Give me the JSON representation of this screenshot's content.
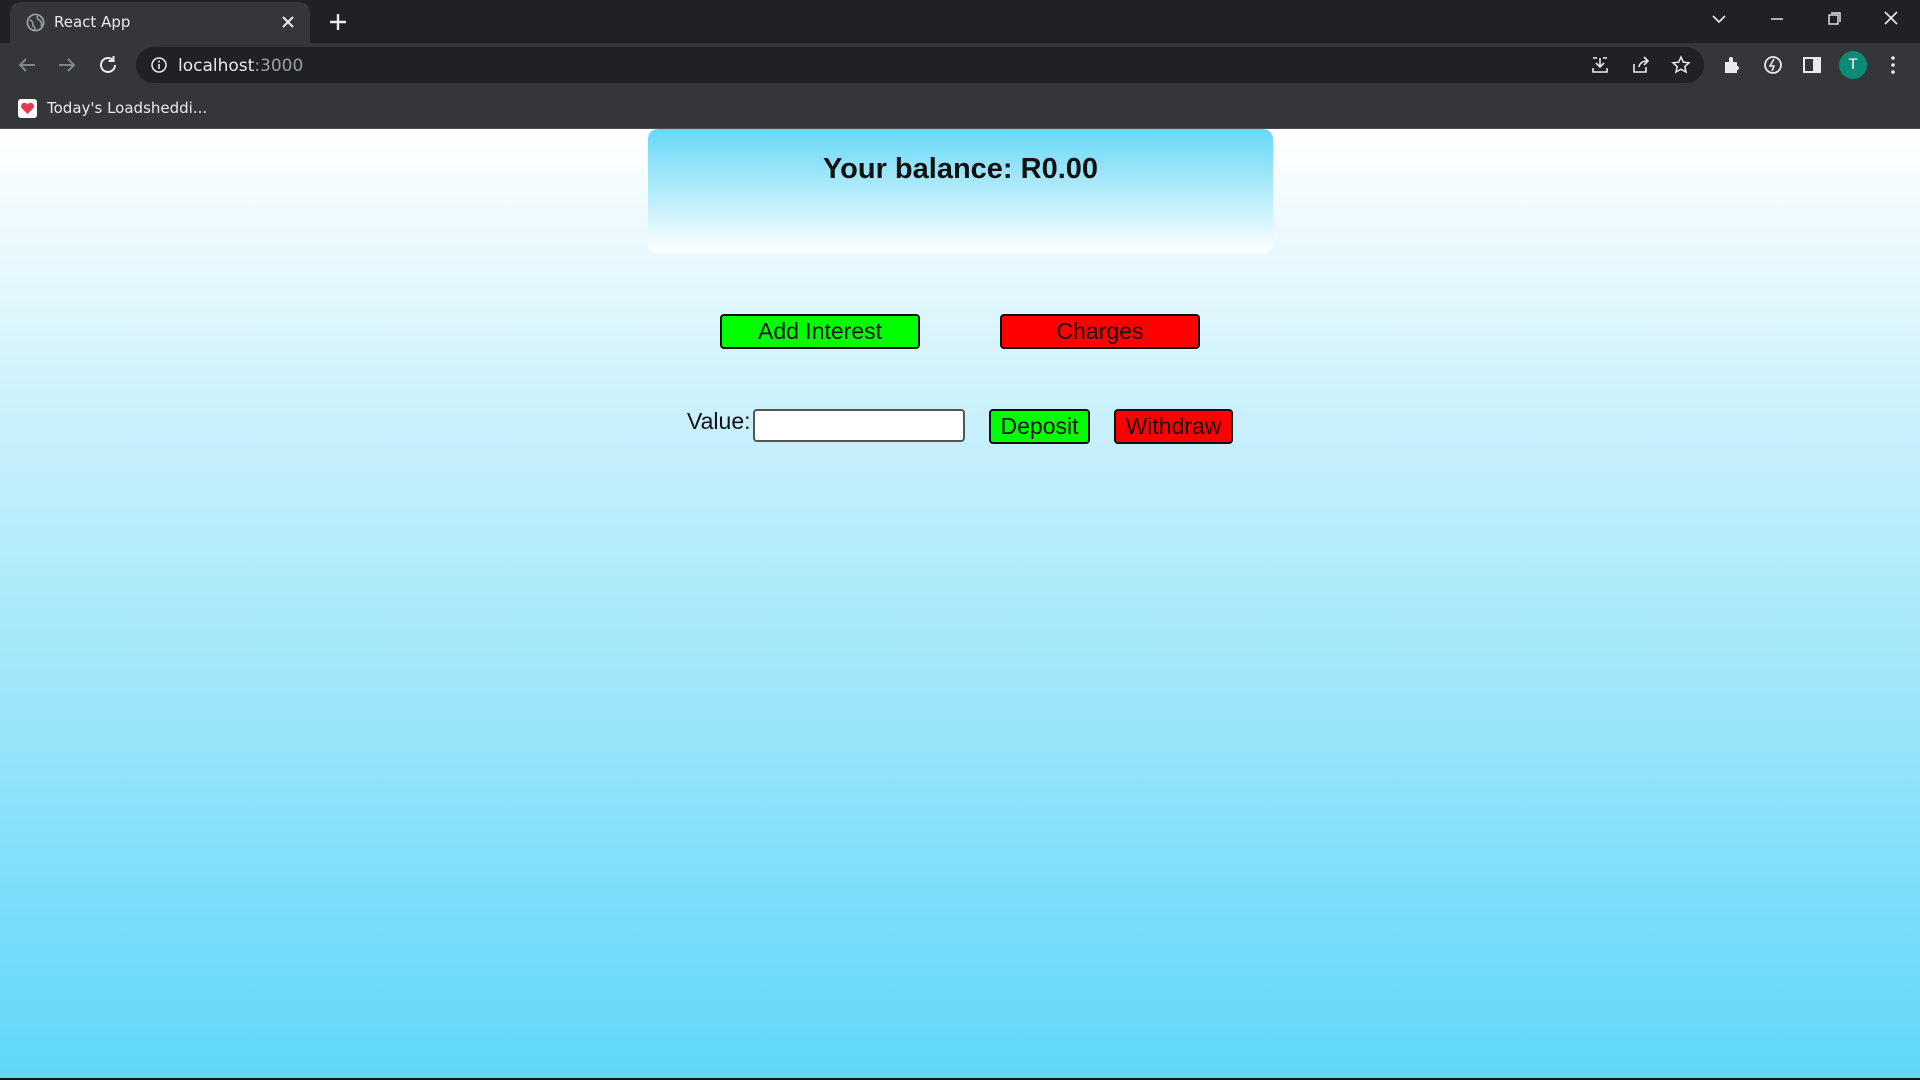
{
  "browser": {
    "tab_title": "React App",
    "url_host": "localhost",
    "url_port": ":3000",
    "bookmark_label": "Today's Loadsheddi...",
    "avatar_letter": "T"
  },
  "app": {
    "balance_text": "Your balance: R0.00",
    "add_interest_label": "Add Interest",
    "charges_label": "Charges",
    "value_label": "Value:",
    "value_input": "",
    "deposit_label": "Deposit",
    "withdraw_label": "Withdraw"
  },
  "colors": {
    "positive": "#00ff00",
    "negative": "#ff0000",
    "accent": "#5fd7f9"
  }
}
